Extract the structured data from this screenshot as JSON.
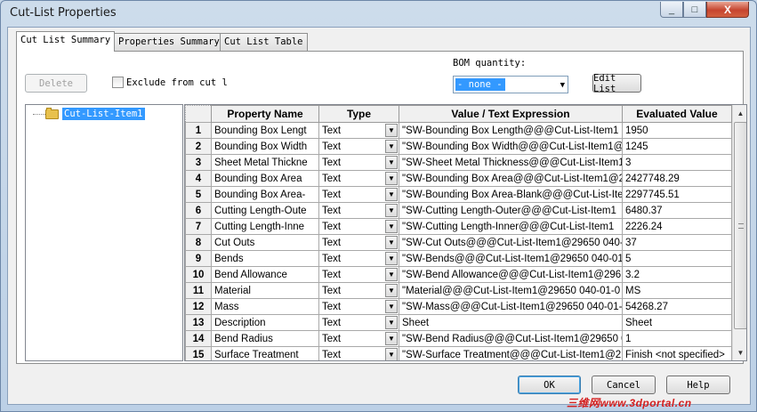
{
  "window": {
    "title": "Cut-List Properties",
    "minimize": "_",
    "maximize": "□",
    "close": "X"
  },
  "tabs": [
    {
      "label": "Cut List Summary",
      "active": true
    },
    {
      "label": "Properties Summary",
      "active": false
    },
    {
      "label": "Cut List Table",
      "active": false
    }
  ],
  "toolbar": {
    "delete_label": "Delete",
    "exclude_label": "Exclude from cut l",
    "bom_label": "BOM quantity:",
    "bom_value": "- none -",
    "edit_list_label": "Edit List"
  },
  "tree": {
    "item": "Cut-List-Item1"
  },
  "grid": {
    "headers": [
      "Property Name",
      "Type",
      "Value / Text Expression",
      "Evaluated Value"
    ],
    "rows": [
      {
        "n": "1",
        "name": "Bounding Box Lengt",
        "type": "Text",
        "expr": "\"SW-Bounding Box Length@@@Cut-List-Item1",
        "value": "1950"
      },
      {
        "n": "2",
        "name": "Bounding Box Width",
        "type": "Text",
        "expr": "\"SW-Bounding Box Width@@@Cut-List-Item1@",
        "value": "1245"
      },
      {
        "n": "3",
        "name": "Sheet Metal Thickne",
        "type": "Text",
        "expr": "\"SW-Sheet Metal Thickness@@@Cut-List-Item1",
        "value": "3"
      },
      {
        "n": "4",
        "name": "Bounding Box Area",
        "type": "Text",
        "expr": "\"SW-Bounding Box Area@@@Cut-List-Item1@2",
        "value": "2427748.29"
      },
      {
        "n": "5",
        "name": "Bounding Box Area-",
        "type": "Text",
        "expr": "\"SW-Bounding Box Area-Blank@@@Cut-List-Ite",
        "value": "2297745.51"
      },
      {
        "n": "6",
        "name": "Cutting Length-Oute",
        "type": "Text",
        "expr": "\"SW-Cutting Length-Outer@@@Cut-List-Item1",
        "value": "6480.37"
      },
      {
        "n": "7",
        "name": "Cutting Length-Inne",
        "type": "Text",
        "expr": "\"SW-Cutting Length-Inner@@@Cut-List-Item1",
        "value": "2226.24"
      },
      {
        "n": "8",
        "name": "Cut Outs",
        "type": "Text",
        "expr": "\"SW-Cut Outs@@@Cut-List-Item1@29650 040-",
        "value": "37"
      },
      {
        "n": "9",
        "name": "Bends",
        "type": "Text",
        "expr": "\"SW-Bends@@@Cut-List-Item1@29650 040-01",
        "value": "5"
      },
      {
        "n": "10",
        "name": "Bend Allowance",
        "type": "Text",
        "expr": "\"SW-Bend Allowance@@@Cut-List-Item1@296",
        "value": "3.2"
      },
      {
        "n": "11",
        "name": "Material",
        "type": "Text",
        "expr": "\"Material@@@Cut-List-Item1@29650 040-01-0",
        "value": "MS"
      },
      {
        "n": "12",
        "name": "Mass",
        "type": "Text",
        "expr": "\"SW-Mass@@@Cut-List-Item1@29650 040-01-",
        "value": "54268.27"
      },
      {
        "n": "13",
        "name": "Description",
        "type": "Text",
        "expr": "Sheet",
        "value": "Sheet"
      },
      {
        "n": "14",
        "name": "Bend Radius",
        "type": "Text",
        "expr": "\"SW-Bend Radius@@@Cut-List-Item1@29650 0",
        "value": "1"
      },
      {
        "n": "15",
        "name": "Surface Treatment",
        "type": "Text",
        "expr": "\"SW-Surface Treatment@@@Cut-List-Item1@2",
        "value": "Finish <not specified>"
      }
    ]
  },
  "footer": {
    "ok_label": "OK",
    "cancel_label": "Cancel",
    "help_label": "Help"
  },
  "watermark": "三维网www.3dportal.cn",
  "icons": {
    "dropdown": "▼",
    "scroll_up": "▲",
    "scroll_down": "▼",
    "folder": "folder-icon"
  }
}
